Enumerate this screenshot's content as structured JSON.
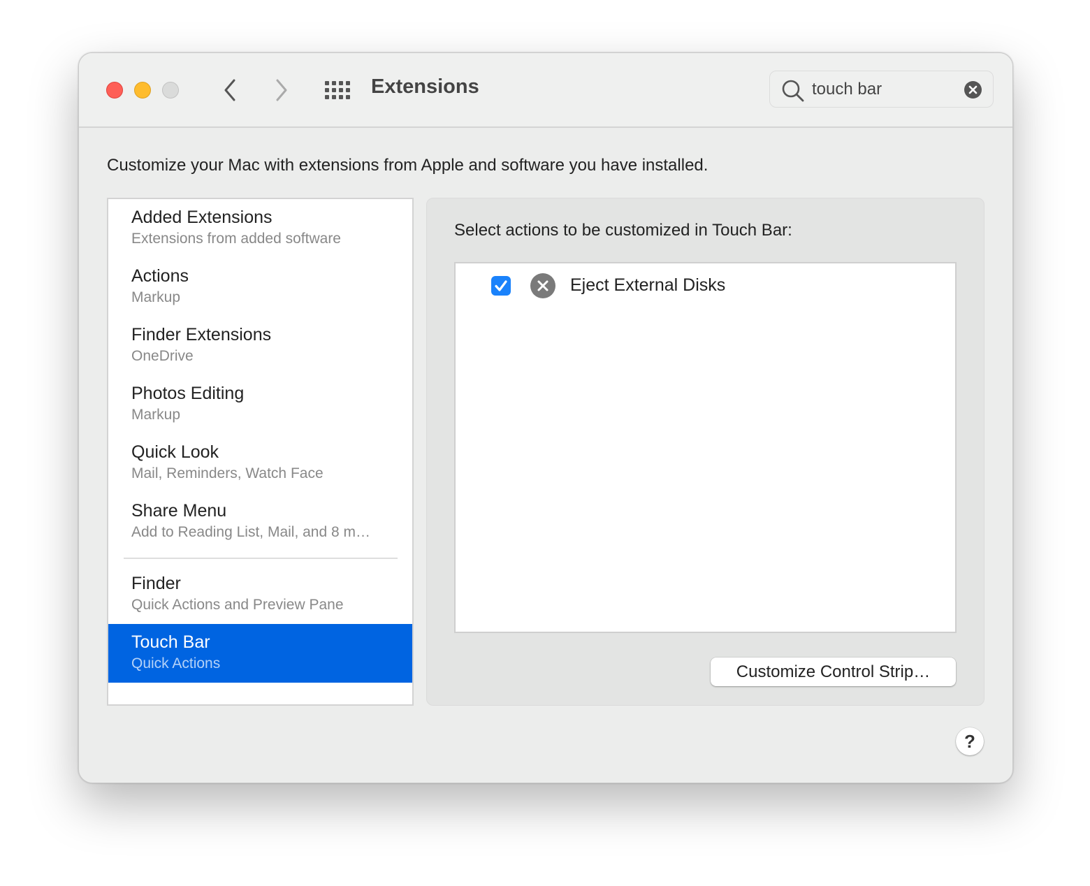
{
  "window": {
    "title": "Extensions",
    "traffic_lights": [
      "close",
      "minimize",
      "zoom"
    ],
    "nav": {
      "back_icon": "chevron-left-icon",
      "forward_icon": "chevron-right-icon",
      "grid_icon": "show-all-grid-icon"
    }
  },
  "search": {
    "value": "touch bar",
    "placeholder": "Search",
    "icon": "magnifier-icon",
    "clear_icon": "clear-icon"
  },
  "description": "Customize your Mac with extensions from Apple and software you have installed.",
  "sidebar": {
    "items": [
      {
        "title": "Added Extensions",
        "subtitle": "Extensions from added software"
      },
      {
        "title": "Actions",
        "subtitle": "Markup"
      },
      {
        "title": "Finder Extensions",
        "subtitle": "OneDrive"
      },
      {
        "title": "Photos Editing",
        "subtitle": "Markup"
      },
      {
        "title": "Quick Look",
        "subtitle": "Mail, Reminders, Watch Face"
      },
      {
        "title": "Share Menu",
        "subtitle": "Add to Reading List, Mail, and 8 m…"
      },
      {
        "title": "Finder",
        "subtitle": "Quick Actions and Preview Pane"
      },
      {
        "title": "Touch Bar",
        "subtitle": "Quick Actions",
        "selected": true
      }
    ]
  },
  "panel": {
    "label": "Select actions to be customized in Touch Bar:",
    "actions": [
      {
        "label": "Eject External Disks",
        "checked": true,
        "icon": "eject-x-icon"
      }
    ],
    "customize_button": "Customize Control Strip…"
  },
  "help_button": "?",
  "colors": {
    "accent": "#0064e1",
    "checkbox": "#1a82fb",
    "close": "#fe5f57",
    "minimize": "#febc2e"
  }
}
